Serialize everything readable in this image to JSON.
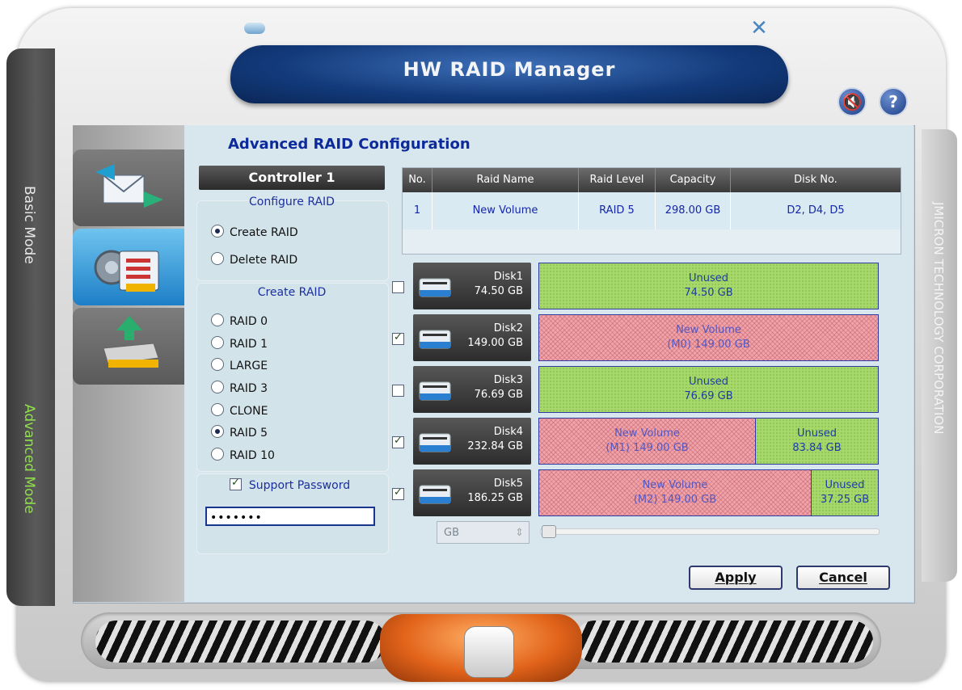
{
  "app": {
    "title": "HW RAID Manager",
    "vendor": "JMICRON TECHNOLOGY CORPORATION"
  },
  "mode_tabs": {
    "basic": "Basic Mode",
    "advanced": "Advanced Mode"
  },
  "heading": "Advanced RAID Configuration",
  "controller": {
    "label": "Controller 1"
  },
  "configure_raid": {
    "title": "Configure RAID",
    "options": [
      {
        "label": "Create RAID",
        "selected": true
      },
      {
        "label": "Delete RAID",
        "selected": false
      }
    ]
  },
  "create_raid": {
    "title": "Create RAID",
    "options": [
      {
        "label": "RAID 0",
        "selected": false
      },
      {
        "label": "RAID 1",
        "selected": false
      },
      {
        "label": "LARGE",
        "selected": false
      },
      {
        "label": "RAID 3",
        "selected": false
      },
      {
        "label": "CLONE",
        "selected": false
      },
      {
        "label": "RAID 5",
        "selected": true
      },
      {
        "label": "RAID 10",
        "selected": false
      }
    ]
  },
  "password": {
    "label": "Support Password",
    "checked": true,
    "value": "•••••••"
  },
  "table": {
    "headers": [
      "No.",
      "Raid Name",
      "Raid Level",
      "Capacity",
      "Disk No."
    ],
    "rows": [
      [
        "1",
        "New Volume",
        "RAID 5",
        "298.00 GB",
        "D2, D4, D5"
      ]
    ]
  },
  "disks": [
    {
      "name": "Disk1",
      "size": "74.50 GB",
      "checked": false,
      "segments": [
        {
          "type": "unused",
          "line1": "Unused",
          "line2": "74.50 GB"
        }
      ]
    },
    {
      "name": "Disk2",
      "size": "149.00 GB",
      "checked": true,
      "segments": [
        {
          "type": "used",
          "line1": "New Volume",
          "line2": "(M0) 149.00 GB"
        }
      ]
    },
    {
      "name": "Disk3",
      "size": "76.69 GB",
      "checked": false,
      "segments": [
        {
          "type": "unused",
          "line1": "Unused",
          "line2": "76.69 GB"
        }
      ]
    },
    {
      "name": "Disk4",
      "size": "232.84 GB",
      "checked": true,
      "segments": [
        {
          "type": "used",
          "line1": "New Volume",
          "line2": "(M1) 149.00 GB"
        },
        {
          "type": "unused",
          "line1": "Unused",
          "line2": "83.84 GB"
        }
      ]
    },
    {
      "name": "Disk5",
      "size": "186.25 GB",
      "checked": true,
      "segments": [
        {
          "type": "used",
          "line1": "New Volume",
          "line2": "(M2) 149.00 GB"
        },
        {
          "type": "unused",
          "line1": "Unused",
          "line2": "37.25 GB"
        }
      ]
    }
  ],
  "size_unit": "GB",
  "buttons": {
    "apply": "Apply",
    "cancel": "Cancel"
  },
  "icons": {
    "sound": "speaker-mute-icon",
    "help": "help-icon",
    "minimize": "minimize-icon",
    "close": "close-icon"
  },
  "colors": {
    "title_bar": "#123a7a",
    "unused": "#a7d96a",
    "used": "#f0a3aa",
    "heading": "#0d2a9a"
  }
}
